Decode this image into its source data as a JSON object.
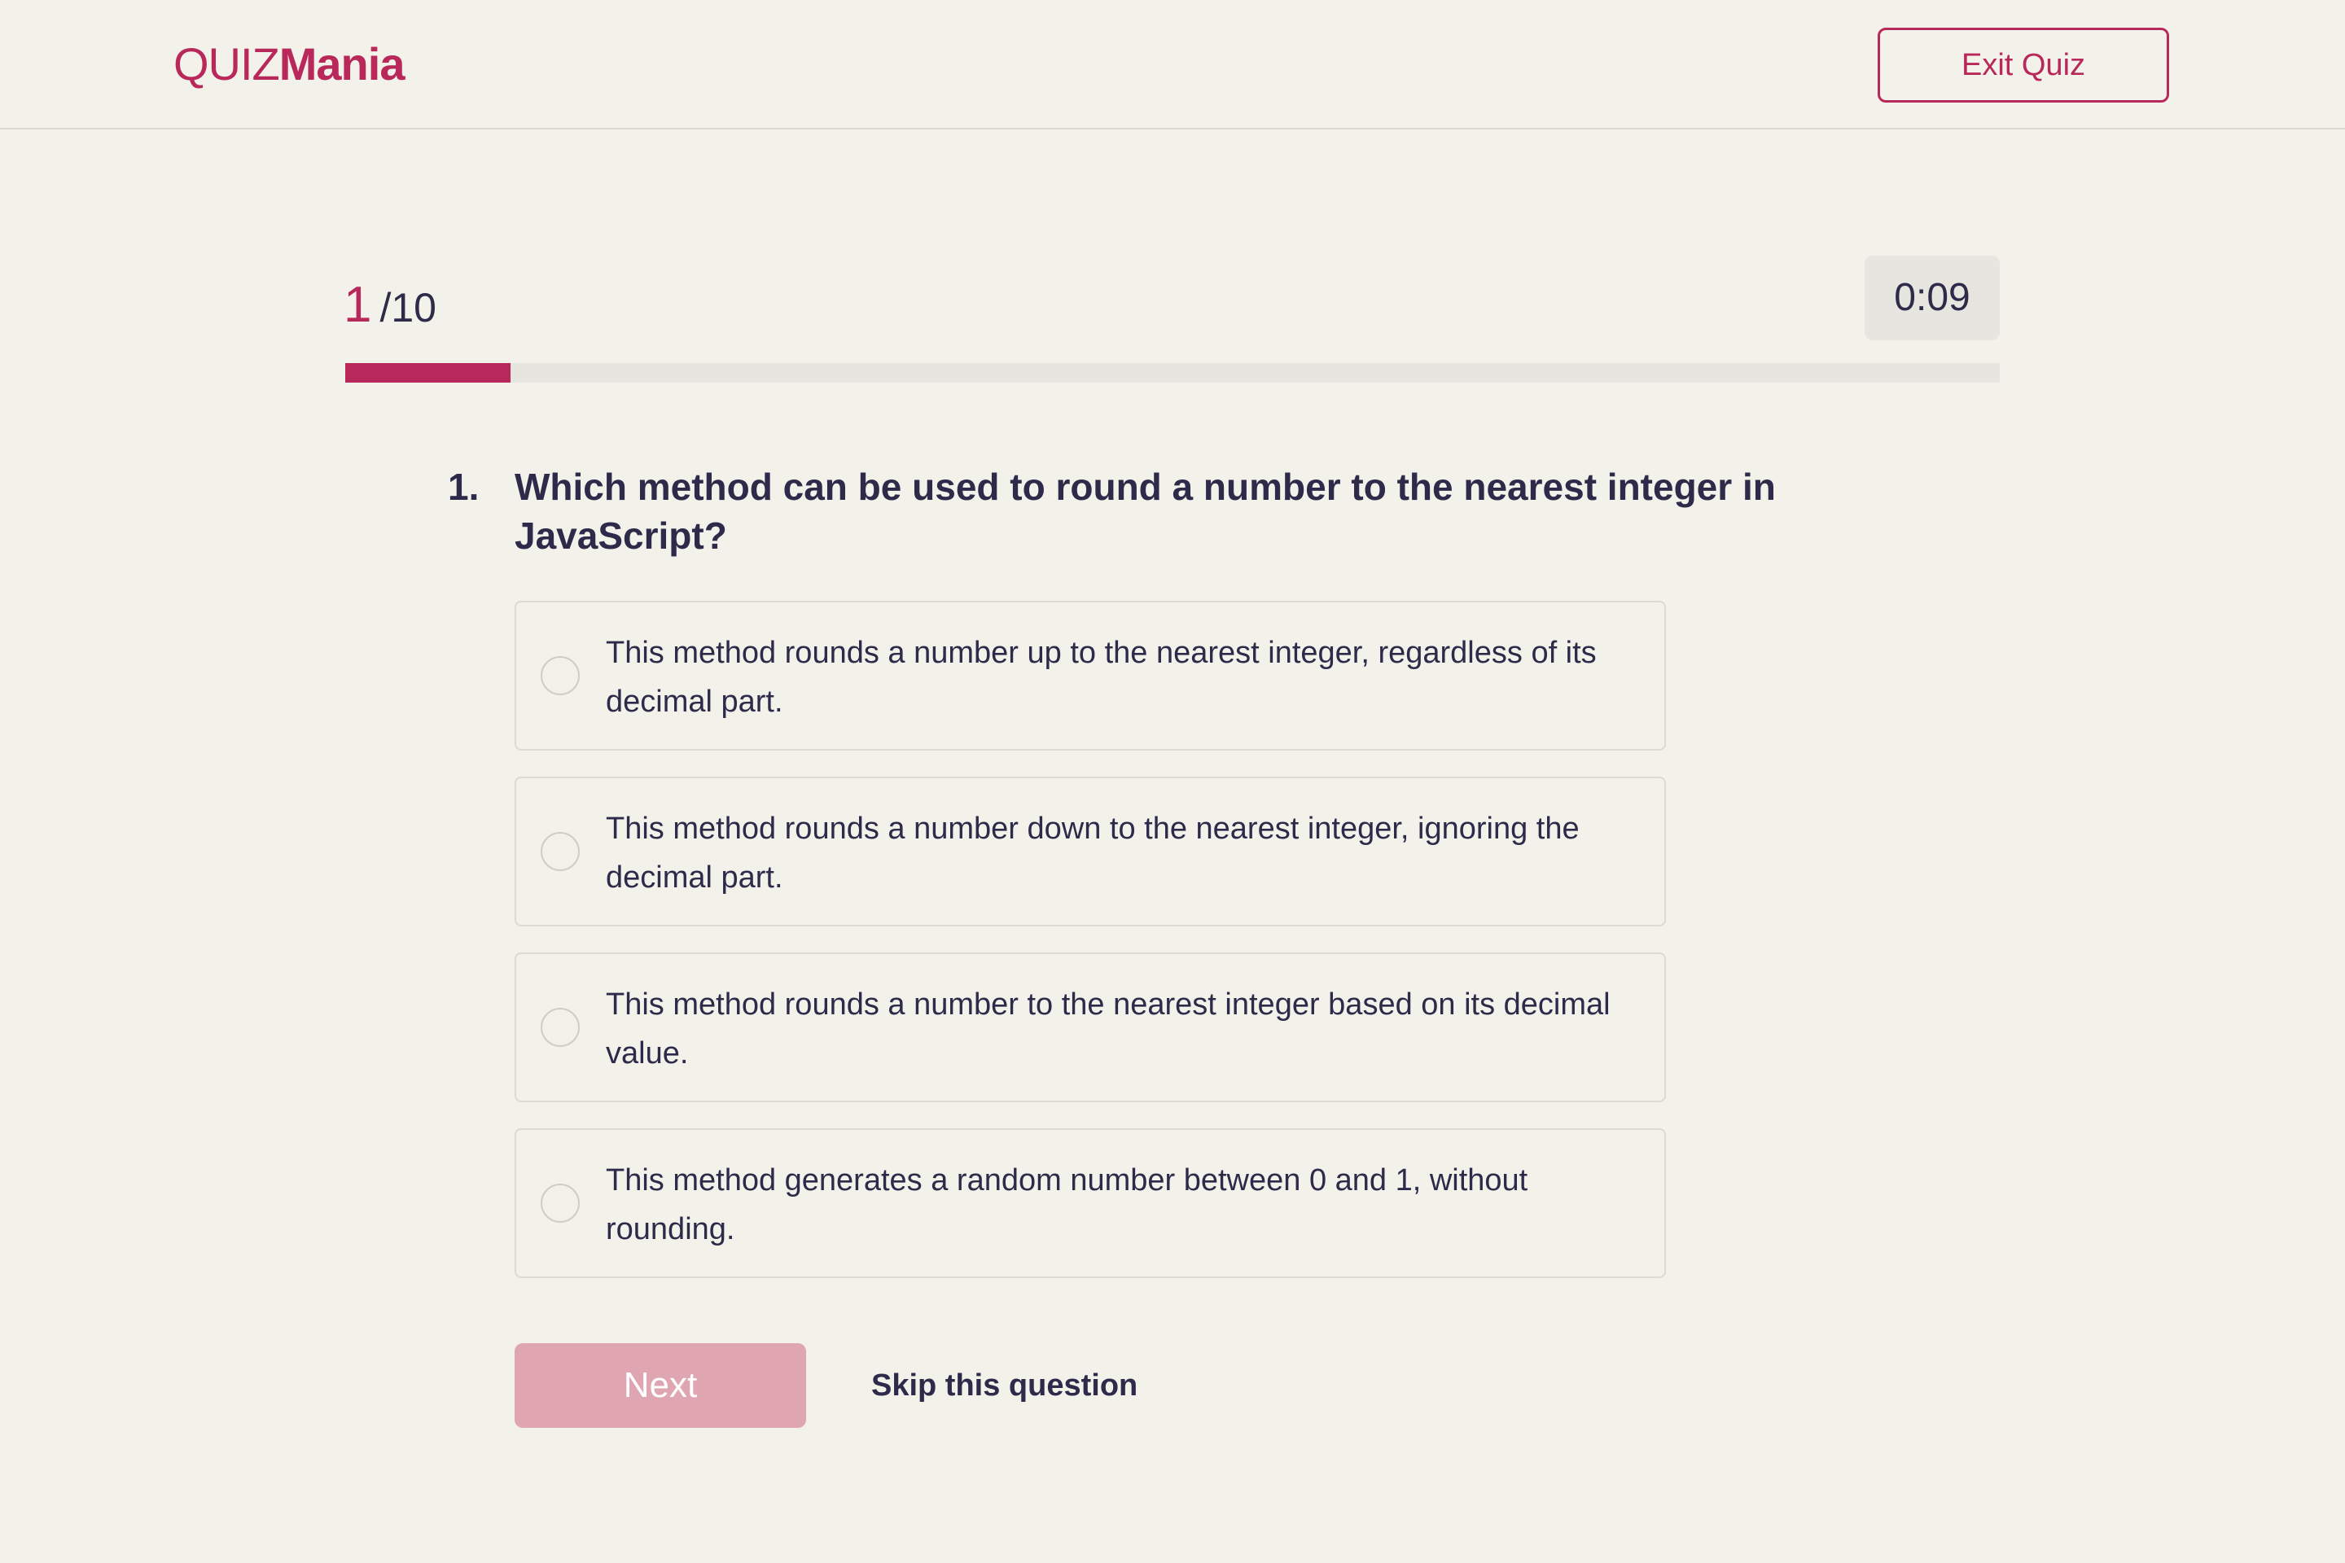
{
  "header": {
    "logo_light": "QUIZ",
    "logo_bold": "Mania",
    "exit_label": "Exit Quiz"
  },
  "progress": {
    "current": "1",
    "total": "/10",
    "fraction": 0.1
  },
  "timer": "0:09",
  "question": {
    "number": "1.",
    "text": "Which method can be used to round a number to the nearest integer in JavaScript?"
  },
  "options": [
    {
      "text": "This method rounds a number up to the nearest integer, regardless of its decimal part."
    },
    {
      "text": "This method rounds a number down to the nearest integer, ignoring the decimal part."
    },
    {
      "text": " This method rounds a number to the nearest integer based on its decimal value."
    },
    {
      "text": "This method generates a random number between 0 and 1, without rounding."
    }
  ],
  "actions": {
    "next_label": "Next",
    "skip_label": "Skip this question"
  },
  "colors": {
    "accent": "#b8285a",
    "accent_disabled": "#dfa5b1",
    "background": "#f3f2ea",
    "text": "#2e2a4a"
  }
}
